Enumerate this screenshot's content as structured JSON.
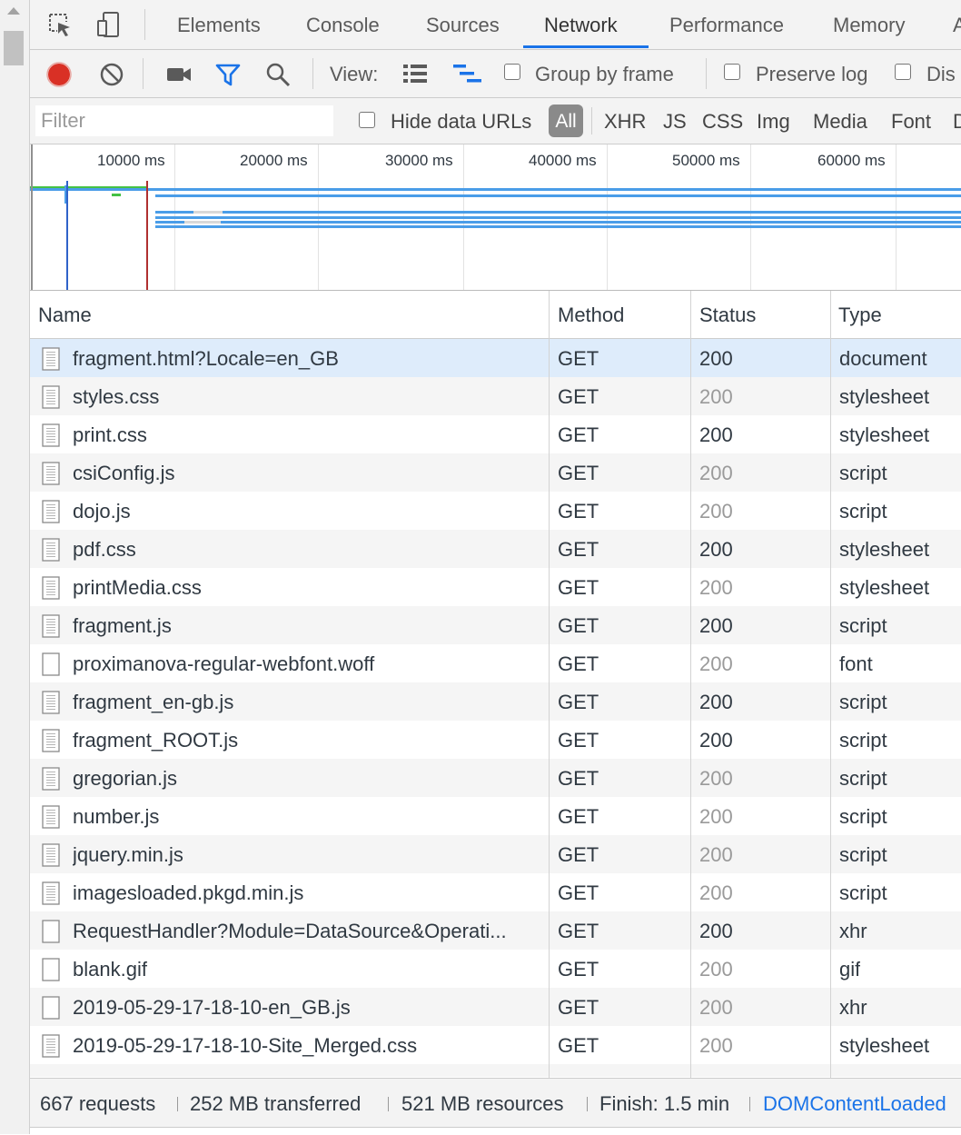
{
  "tabs": [
    "Elements",
    "Console",
    "Sources",
    "Network",
    "Performance",
    "Memory"
  ],
  "active_tab": "Network",
  "toolbar": {
    "view_label": "View:",
    "group_by_frame": "Group by frame",
    "preserve_log": "Preserve log",
    "disable_cache": "Dis"
  },
  "filterbar": {
    "filter_placeholder": "Filter",
    "hide_data_urls": "Hide data URLs",
    "types": [
      "All",
      "XHR",
      "JS",
      "CSS",
      "Img",
      "Media",
      "Font",
      "D"
    ]
  },
  "timeline": {
    "ticks": [
      "10000 ms",
      "20000 ms",
      "30000 ms",
      "40000 ms",
      "50000 ms",
      "60000 ms"
    ]
  },
  "table": {
    "headers": {
      "name": "Name",
      "method": "Method",
      "status": "Status",
      "type": "Type"
    },
    "rows": [
      {
        "name": "fragment.html?Locale=en_GB",
        "method": "GET",
        "status": "200",
        "type": "document",
        "icon": "document-icon",
        "dim": false
      },
      {
        "name": "styles.css",
        "method": "GET",
        "status": "200",
        "type": "stylesheet",
        "icon": "document-icon",
        "dim": true
      },
      {
        "name": "print.css",
        "method": "GET",
        "status": "200",
        "type": "stylesheet",
        "icon": "document-icon",
        "dim": false
      },
      {
        "name": "csiConfig.js",
        "method": "GET",
        "status": "200",
        "type": "script",
        "icon": "document-icon",
        "dim": true
      },
      {
        "name": "dojo.js",
        "method": "GET",
        "status": "200",
        "type": "script",
        "icon": "document-icon",
        "dim": true
      },
      {
        "name": "pdf.css",
        "method": "GET",
        "status": "200",
        "type": "stylesheet",
        "icon": "document-icon",
        "dim": false
      },
      {
        "name": "printMedia.css",
        "method": "GET",
        "status": "200",
        "type": "stylesheet",
        "icon": "document-icon",
        "dim": true
      },
      {
        "name": "fragment.js",
        "method": "GET",
        "status": "200",
        "type": "script",
        "icon": "document-icon",
        "dim": false
      },
      {
        "name": "proximanova-regular-webfont.woff",
        "method": "GET",
        "status": "200",
        "type": "font",
        "icon": "blank-file-icon",
        "dim": true
      },
      {
        "name": "fragment_en-gb.js",
        "method": "GET",
        "status": "200",
        "type": "script",
        "icon": "document-icon",
        "dim": false
      },
      {
        "name": "fragment_ROOT.js",
        "method": "GET",
        "status": "200",
        "type": "script",
        "icon": "document-icon",
        "dim": false
      },
      {
        "name": "gregorian.js",
        "method": "GET",
        "status": "200",
        "type": "script",
        "icon": "document-icon",
        "dim": true
      },
      {
        "name": "number.js",
        "method": "GET",
        "status": "200",
        "type": "script",
        "icon": "document-icon",
        "dim": true
      },
      {
        "name": "jquery.min.js",
        "method": "GET",
        "status": "200",
        "type": "script",
        "icon": "document-icon",
        "dim": true
      },
      {
        "name": "imagesloaded.pkgd.min.js",
        "method": "GET",
        "status": "200",
        "type": "script",
        "icon": "document-icon",
        "dim": true
      },
      {
        "name": "RequestHandler?Module=DataSource&Operati...",
        "method": "GET",
        "status": "200",
        "type": "xhr",
        "icon": "blank-file-icon",
        "dim": false
      },
      {
        "name": "blank.gif",
        "method": "GET",
        "status": "200",
        "type": "gif",
        "icon": "blank-file-icon",
        "dim": true
      },
      {
        "name": "2019-05-29-17-18-10-en_GB.js",
        "method": "GET",
        "status": "200",
        "type": "xhr",
        "icon": "blank-file-icon",
        "dim": true
      },
      {
        "name": "2019-05-29-17-18-10-Site_Merged.css",
        "method": "GET",
        "status": "200",
        "type": "stylesheet",
        "icon": "document-icon",
        "dim": true
      }
    ]
  },
  "statusbar": {
    "requests": "667 requests",
    "transferred": "252 MB transferred",
    "resources": "521 MB resources",
    "finish": "Finish: 1.5 min",
    "dcl": "DOMContentLoaded"
  },
  "colors": {
    "record_red": "#d93025",
    "accent_blue": "#1a73e8",
    "link_blue": "#1a73e8",
    "bar_blue": "#4a9de8",
    "bar_green": "#44c144",
    "dcl_line": "#2f62c9",
    "load_line": "#b03030"
  }
}
